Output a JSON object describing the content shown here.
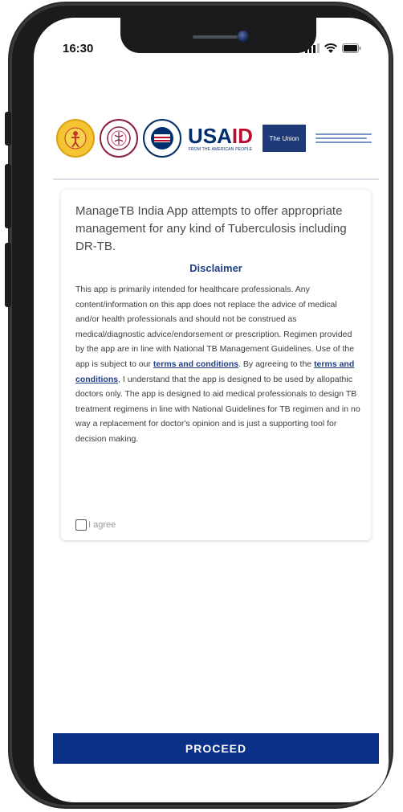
{
  "status_bar": {
    "time": "16:30",
    "icons": [
      "signal-icon",
      "wifi-icon",
      "battery-icon"
    ]
  },
  "logos": {
    "items": [
      "emblem-logo",
      "seal-logo",
      "usaid-seal-icon",
      "usaid-logo",
      "the-union-logo"
    ],
    "usaid_part1": "USA",
    "usaid_part2": "ID",
    "usaid_tagline": "FROM THE AMERICAN PEOPLE",
    "union_label": "The Union"
  },
  "card": {
    "intro": "ManageTB India App attempts to offer appropriate management for any kind of Tuberculosis including DR-TB.",
    "disclaimer_title": "Disclaimer",
    "body_part1": "This app is primarily intended for healthcare professionals. Any content/information on this app does not replace the advice of medical and/or health professionals and should not be construed as medical/diagnostic advice/endorsement or prescription. Regimen provided by the app are in line with National TB Management Guidelines. Use of the app is subject to our ",
    "terms_link_1": "terms and conditions",
    "body_part2": ". By agreeing to the ",
    "terms_link_2": "terms and conditions",
    "body_part3": ", I understand that the app is designed to be used by allopathic doctors only. The app is designed to aid medical professionals to design TB treatment regimens in line with National Guidelines for TB regimen and in no way a replacement for doctor's opinion and is just a supporting tool for decision making.",
    "agree_label": "I agree",
    "agree_checked": false
  },
  "proceed_label": "PROCEED",
  "colors": {
    "primary": "#0b3087",
    "link": "#1f3f86",
    "usaid_blue": "#002f6c",
    "usaid_red": "#ba0c2f"
  }
}
